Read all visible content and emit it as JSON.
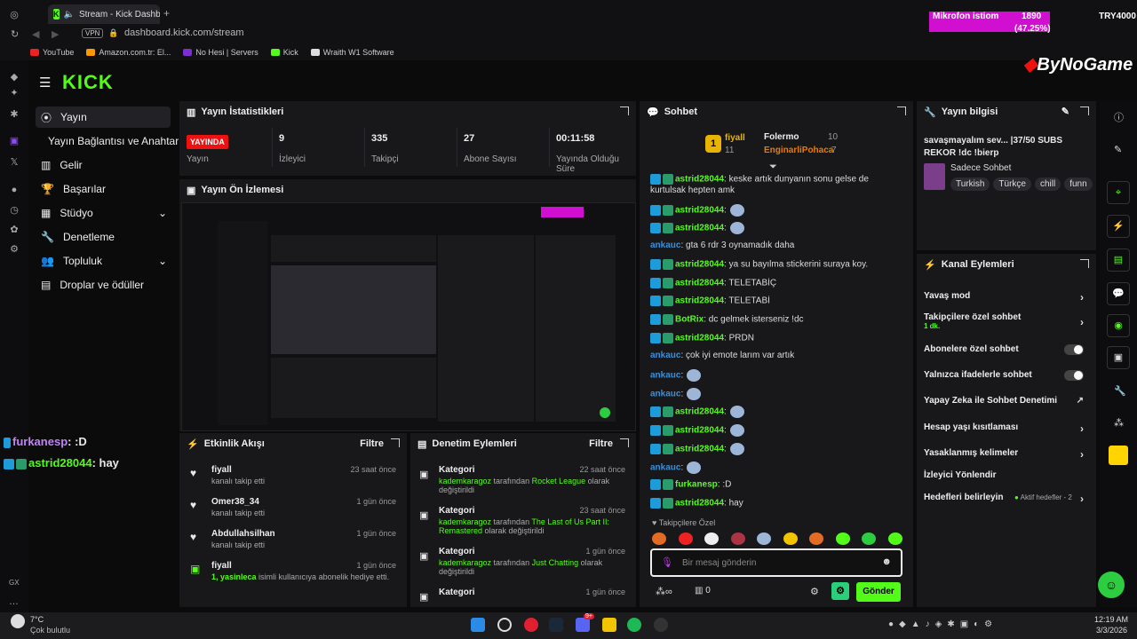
{
  "browser": {
    "tab_title": "Stream - Kick Dashbo",
    "url": "dashboard.kick.com/stream",
    "bookmarks": [
      "YouTube",
      "Amazon.com.tr: El...",
      "No Hesi | Servers",
      "Kick",
      "Wraith W1 Software"
    ],
    "mic_overlay": "Mikrofon istiom",
    "mic_count": "1890",
    "mic_percent": "(47.25%)",
    "currency": "TRY4000",
    "sponsor": "ByNoGame"
  },
  "nav": {
    "logo": "KICK",
    "items": [
      "Yayın",
      "Yayın Bağlantısı ve Anahtarı",
      "Gelir",
      "Başarılar",
      "Stüdyo",
      "Denetleme",
      "Topluluk",
      "Droplar ve ödüller"
    ],
    "bottom_label": "GX"
  },
  "stats": {
    "title": "Yayın İstatistikleri",
    "live": "YAYINDA",
    "live_label": "Yayın",
    "viewers": "9",
    "viewers_label": "İzleyici",
    "followers": "335",
    "followers_label": "Takipçi",
    "subs": "27",
    "subs_label": "Abone Sayısı",
    "time": "00:11:58",
    "time_label": "Yayında Olduğu Süre"
  },
  "preview": {
    "title": "Yayın Ön İzlemesi"
  },
  "overlay_chat": [
    {
      "user": "furkanesp",
      "msg": ": :D"
    },
    {
      "user": "astrid28044",
      "msg": ": hay"
    }
  ],
  "activity": {
    "title": "Etkinlik Akışı",
    "filter": "Filtre",
    "items": [
      {
        "name": "fiyall",
        "desc": "kanalı takip etti",
        "time": "23 saat önce"
      },
      {
        "name": "Omer38_34",
        "desc": "kanalı takip etti",
        "time": "1 gün önce"
      },
      {
        "name": "Abdullahsilhan",
        "desc": "kanalı takip etti",
        "time": "1 gün önce"
      },
      {
        "name": "fiyall",
        "desc_green": "1, yasinleca",
        "desc": " isimli kullanıcıya abonelik hediye etti.",
        "time": "1 gün önce"
      }
    ]
  },
  "moderation": {
    "title": "Denetim Eylemleri",
    "filter": "Filtre",
    "items": [
      {
        "title": "Kategori",
        "time": "22 saat önce",
        "user": "kademkaragoz",
        "mid": " tarafından ",
        "cat": "Rocket League",
        "end": " olarak değiştirildi"
      },
      {
        "title": "Kategori",
        "time": "23 saat önce",
        "user": "kademkaragoz",
        "mid": " tarafından ",
        "cat": "The Last of Us Part II: Remastered",
        "end": " olarak değiştirildi"
      },
      {
        "title": "Kategori",
        "time": "1 gün önce",
        "user": "kademkaragoz",
        "mid": " tarafından ",
        "cat": "Just Chatting",
        "end": " olarak değiştirildi"
      },
      {
        "title": "Kategori",
        "time": "1 gün önce",
        "user": "",
        "mid": "",
        "cat": "",
        "end": ""
      }
    ]
  },
  "chat": {
    "title": "Sohbet",
    "top": [
      {
        "name": "fiyall",
        "count": "11"
      },
      {
        "name": "Folermo",
        "count": "10"
      },
      {
        "name": "EnginarliPohaca",
        "count": "7"
      }
    ],
    "messages": [
      {
        "user": "astrid28044",
        "text": ": keske artık dunyanın sonu gelse de",
        "text2": "kurtulsak hepten amk"
      },
      {
        "user": "astrid28044",
        "text": ":"
      },
      {
        "user": "astrid28044",
        "text": ":"
      },
      {
        "user": "ankauc",
        "text": ": gta 6 rdr 3 oynamadık daha"
      },
      {
        "user": "astrid28044",
        "text": ": ya su bayılma stickerini suraya koy."
      },
      {
        "user": "astrid28044",
        "text": ": TELETABİÇ"
      },
      {
        "user": "astrid28044",
        "text": ": TELETABİ"
      },
      {
        "user": "BotRix",
        "text": ": dc gelmek isterseniz !dc"
      },
      {
        "user": "astrid28044",
        "text": ": PRDN"
      },
      {
        "user": "ankauc",
        "text": ": çok iyi emote larım var artık"
      },
      {
        "user": "ankauc",
        "text": ":"
      },
      {
        "user": "ankauc",
        "text": ":"
      },
      {
        "user": "astrid28044",
        "text": ":"
      },
      {
        "user": "astrid28044",
        "text": ":"
      },
      {
        "user": "astrid28044",
        "text": ":"
      },
      {
        "user": "ankauc",
        "text": ":"
      },
      {
        "user": "furkanesp",
        "text": ": :D"
      },
      {
        "user": "astrid28044",
        "text": ": hay"
      }
    ],
    "followers_only": "Takipçilere Özel",
    "placeholder": "Bir mesaj gönderin",
    "points": "0",
    "send": "Gönder"
  },
  "info": {
    "title": "Yayın bilgisi",
    "stream_title": "savaşmayalım sev... |37/50 SUBS REKOR !dc !bierp",
    "category": "Sadece Sohbet",
    "tags": [
      "Turkish",
      "Türkçe",
      "chill",
      "funn"
    ]
  },
  "actions": {
    "title": "Kanal Eylemleri",
    "items": [
      {
        "label": "Yavaş mod",
        "type": "chev"
      },
      {
        "label": "Takipçilere özel sohbet",
        "sub": "1 dk.",
        "type": "chev"
      },
      {
        "label": "Abonelere özel sohbet",
        "type": "toggle"
      },
      {
        "label": "Yalnızca ifadelerle sohbet",
        "type": "toggle"
      },
      {
        "label": "Yapay Zeka ile Sohbet Denetimi",
        "type": "ext"
      },
      {
        "label": "Hesap yaşı kısıtlaması",
        "type": "chev"
      },
      {
        "label": "Yasaklanmış kelimeler",
        "type": "chev"
      },
      {
        "label": "İzleyici Yönlendir",
        "type": "none"
      },
      {
        "label": "Hedefleri belirleyin",
        "extra": "Aktif hedefler - 2",
        "type": "chev"
      }
    ]
  },
  "taskbar": {
    "weather_temp": "7°C",
    "weather_desc": "Çok bulutlu",
    "time": "12:19 AM",
    "date": "3/3/2026",
    "discord_count": "9+"
  }
}
